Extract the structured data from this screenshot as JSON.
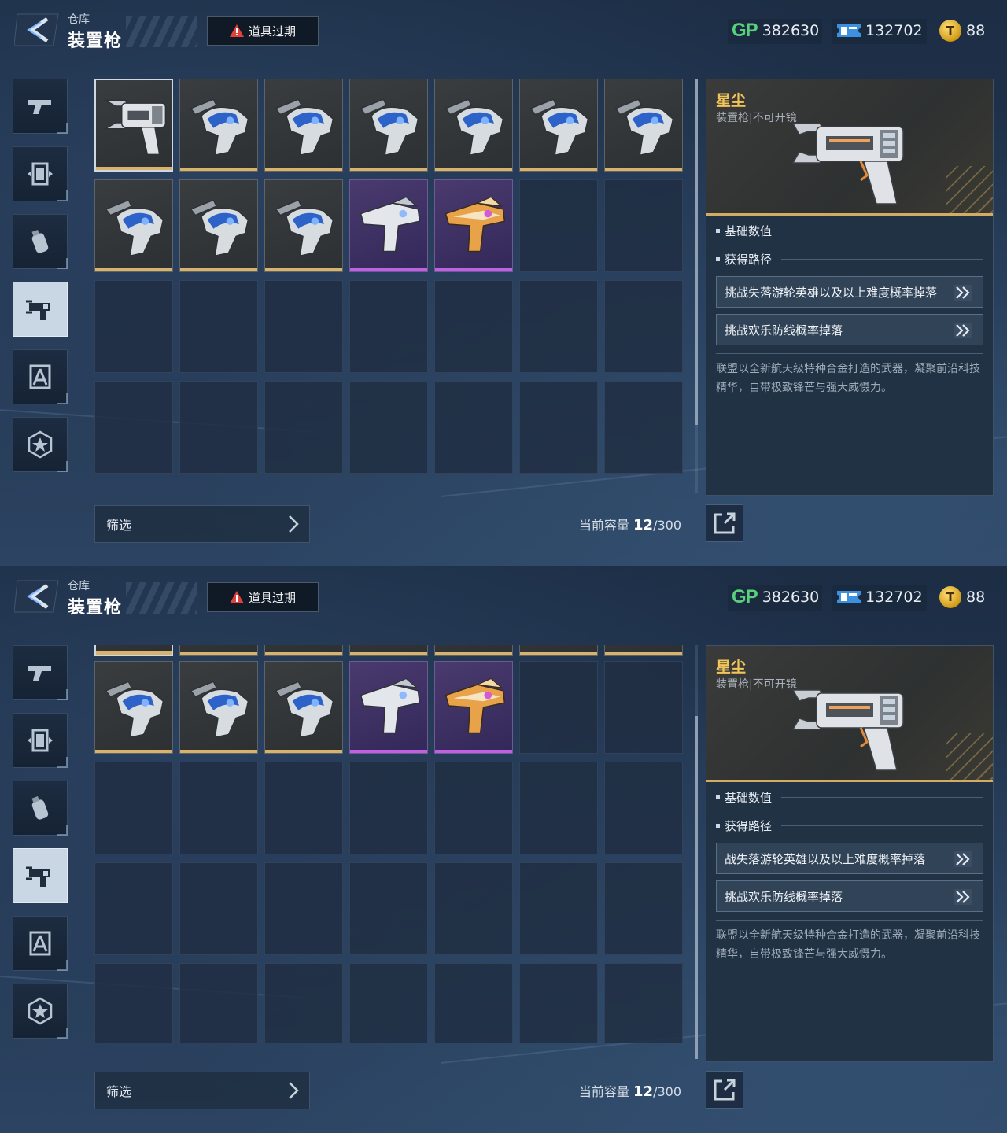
{
  "screens": [
    {
      "header": {
        "subtitle": "仓库",
        "title": "装置枪",
        "expire_label": "道具过期"
      },
      "currency": {
        "gp_label": "GP",
        "gp": "382630",
        "tickets": "132702",
        "coins": "88"
      },
      "footer": {
        "filter_label": "筛选",
        "capacity_label": "当前容量",
        "capacity_used": "12",
        "capacity_total": "/300"
      },
      "detail": {
        "name": "星尘",
        "type": "装置枪|不可开镜",
        "section_base": "基础数值",
        "section_source": "获得路径",
        "path1": "挑战失落游轮英雄以及以上难度概率掉落",
        "path2": "挑战欢乐防线概率掉落",
        "description": "联盟以全新航天级特种合金打造的武器，凝聚前沿科技精华，自带极致锋芒与强大威慑力。"
      },
      "items": [
        {
          "kind": "stardust",
          "rarity": "gold",
          "selected": true
        },
        {
          "kind": "blue",
          "rarity": "gold"
        },
        {
          "kind": "blue",
          "rarity": "gold"
        },
        {
          "kind": "blue",
          "rarity": "gold"
        },
        {
          "kind": "blue",
          "rarity": "gold"
        },
        {
          "kind": "blue",
          "rarity": "gold"
        },
        {
          "kind": "blue",
          "rarity": "gold"
        },
        {
          "kind": "blue",
          "rarity": "gold"
        },
        {
          "kind": "blue",
          "rarity": "gold"
        },
        {
          "kind": "blue",
          "rarity": "gold"
        },
        {
          "kind": "white",
          "rarity": "purple"
        },
        {
          "kind": "gold",
          "rarity": "purple"
        }
      ]
    },
    {
      "header": {
        "subtitle": "仓库",
        "title": "装置枪",
        "expire_label": "道具过期"
      },
      "currency": {
        "gp_label": "GP",
        "gp": "382630",
        "tickets": "132702",
        "coins": "88"
      },
      "footer": {
        "filter_label": "筛选",
        "capacity_label": "当前容量",
        "capacity_used": "12",
        "capacity_total": "/300"
      },
      "detail": {
        "name": "星尘",
        "type": "装置枪|不可开镜",
        "section_base": "基础数值",
        "section_source": "获得路径",
        "path1": "战失落游轮英雄以及以上难度概率掉落",
        "path2": "挑战欢乐防线概率掉落",
        "description": "联盟以全新航天级特种合金打造的武器，凝聚前沿科技精华，自带极致锋芒与强大威慑力。"
      },
      "items": [
        {
          "kind": "blue",
          "rarity": "gold"
        },
        {
          "kind": "blue",
          "rarity": "gold"
        },
        {
          "kind": "blue",
          "rarity": "gold"
        },
        {
          "kind": "white",
          "rarity": "purple"
        },
        {
          "kind": "gold",
          "rarity": "purple"
        }
      ]
    }
  ],
  "nav_icons": [
    "pistol-icon",
    "card-icon",
    "grenade-icon",
    "device-gun-icon",
    "compass-icon",
    "star-badge-icon"
  ],
  "colors": {
    "gold_bar": "#d9b36b",
    "purple_bar": "#c062e0",
    "name": "#f2c55b",
    "gp": "#58d07c"
  }
}
